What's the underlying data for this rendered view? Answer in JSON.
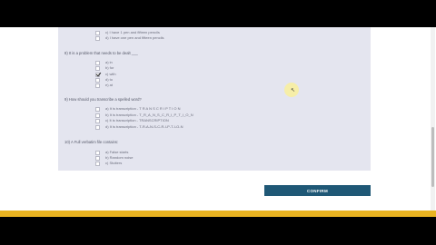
{
  "colors": {
    "panel_bg": "#e4e5ef",
    "confirm_bg": "#1f5876",
    "accent_bar": "#e9b321",
    "letterbox": "#000000"
  },
  "questions": [
    {
      "text": "",
      "options": [
        {
          "label": "c) I have 1 pen and fifteen pencils",
          "checked": false
        },
        {
          "label": "d) I have one pen and fifteen pencils",
          "checked": false
        }
      ]
    },
    {
      "text": "8) It is a problem that needs to be dealt ___",
      "options": [
        {
          "label": "a) in",
          "checked": false
        },
        {
          "label": "b) for",
          "checked": false
        },
        {
          "label": "c) with",
          "checked": true
        },
        {
          "label": "d) to",
          "checked": false
        },
        {
          "label": "e) at",
          "checked": false
        }
      ]
    },
    {
      "text": "9) How should you transcribe a spelled word?",
      "options": [
        {
          "label": "a) It is transcription - T R A N S C R I P T I O N",
          "checked": false
        },
        {
          "label": "b) It is transcription - T_R_A_N_S_C_R_I_P_T_I_O_N",
          "checked": false
        },
        {
          "label": "c) It is transcription - TRANSCRIPTION",
          "checked": false
        },
        {
          "label": "d) It is transcription - T-R-A-N-S-C-R-I-P-T-I-O-N",
          "checked": false
        }
      ]
    },
    {
      "text": "10) A Full verbatim file contains:",
      "options": [
        {
          "label": "a) False starts",
          "checked": false
        },
        {
          "label": "b) Random noise",
          "checked": false
        },
        {
          "label": "c) Stutters",
          "checked": false
        }
      ]
    }
  ],
  "confirm_label": "CONFIRM"
}
